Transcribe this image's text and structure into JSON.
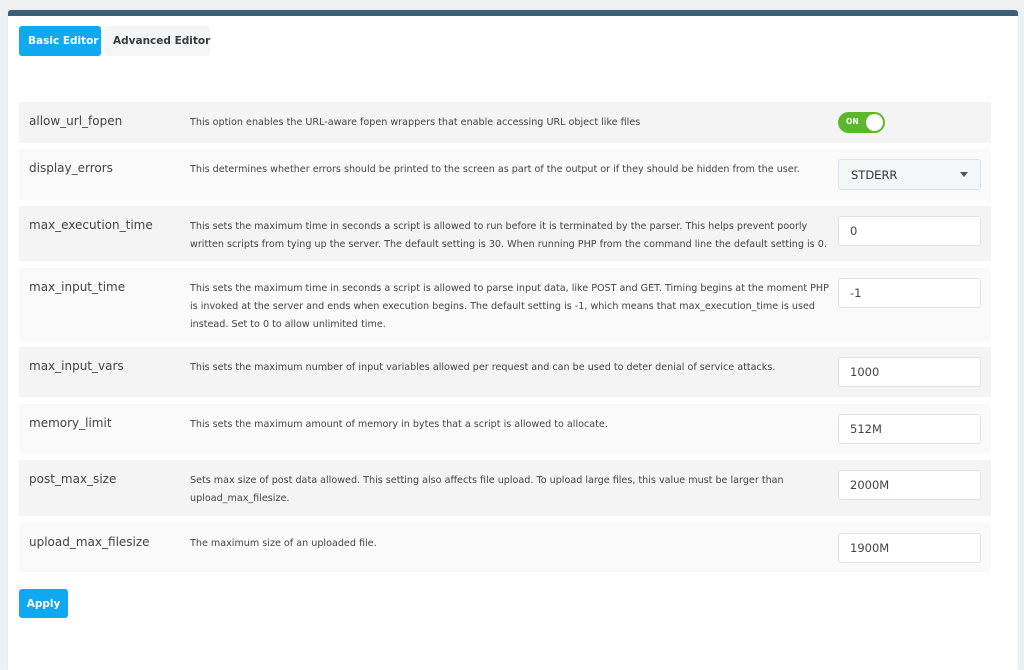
{
  "tabs": [
    {
      "label": "Basic Editor",
      "active": true
    },
    {
      "label": "Advanced Editor",
      "active": false
    }
  ],
  "settings": [
    {
      "name": "allow_url_fopen",
      "description": "This option enables the URL-aware fopen wrappers that enable accessing URL object like files",
      "control": "toggle",
      "value": "ON"
    },
    {
      "name": "display_errors",
      "description": "This determines whether errors should be printed to the screen as part of the output or if they should be hidden from the user.",
      "control": "select",
      "value": "STDERR"
    },
    {
      "name": "max_execution_time",
      "description": "This sets the maximum time in seconds a script is allowed to run before it is terminated by the parser. This helps prevent poorly written scripts from tying up the server. The default setting is 30. When running PHP from the command line the default setting is 0.",
      "control": "input",
      "value": "0"
    },
    {
      "name": "max_input_time",
      "description": "This sets the maximum time in seconds a script is allowed to parse input data, like POST and GET. Timing begins at the moment PHP is invoked at the server and ends when execution begins. The default setting is -1, which means that max_execution_time is used instead. Set to 0 to allow unlimited time.",
      "control": "input",
      "value": "-1"
    },
    {
      "name": "max_input_vars",
      "description": "This sets the maximum number of input variables allowed per request and can be used to deter denial of service attacks.",
      "control": "input",
      "value": "1000"
    },
    {
      "name": "memory_limit",
      "description": "This sets the maximum amount of memory in bytes that a script is allowed to allocate.",
      "control": "input",
      "value": "512M"
    },
    {
      "name": "post_max_size",
      "description": "Sets max size of post data allowed. This setting also affects file upload. To upload large files, this value must be larger than upload_max_filesize.",
      "control": "input",
      "value": "2000M"
    },
    {
      "name": "upload_max_filesize",
      "description": "The maximum size of an uploaded file.",
      "control": "input",
      "value": "1900M"
    }
  ],
  "apply_label": "Apply",
  "colors": {
    "accent": "#0fa9f2",
    "toggle_on": "#5cb82a",
    "header_bar": "#3d6078"
  }
}
